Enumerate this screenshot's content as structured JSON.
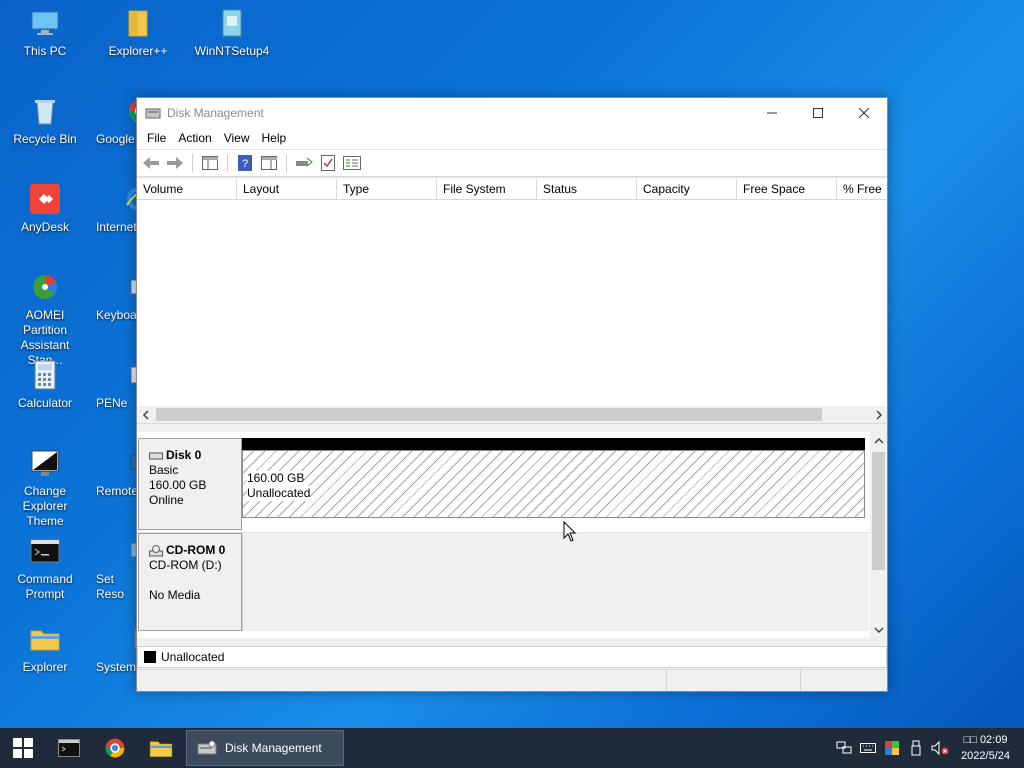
{
  "desktop": {
    "icons": [
      {
        "label": "This PC"
      },
      {
        "label": "Explorer++"
      },
      {
        "label": "WinNTSetup4"
      },
      {
        "label": "Recycle Bin"
      },
      {
        "label": "Google"
      },
      {
        "label": "AnyDesk"
      },
      {
        "label": "Internet"
      },
      {
        "label": "AOMEI Partition Assistant Stan..."
      },
      {
        "label": "Keyboa"
      },
      {
        "label": "Calculator"
      },
      {
        "label": "PENe"
      },
      {
        "label": "Change Explorer Theme"
      },
      {
        "label": "Remote"
      },
      {
        "label": "Command Prompt"
      },
      {
        "label": "Set Reso"
      },
      {
        "label": "Explorer"
      },
      {
        "label": "System"
      }
    ]
  },
  "window": {
    "title": "Disk Management",
    "menu": [
      "File",
      "Action",
      "View",
      "Help"
    ],
    "columns": [
      "Volume",
      "Layout",
      "Type",
      "File System",
      "Status",
      "Capacity",
      "Free Space",
      "% Free"
    ],
    "disks": [
      {
        "name": "Disk 0",
        "type": "Basic",
        "size": "160.00 GB",
        "status": "Online",
        "partition": {
          "size": "160.00 GB",
          "label": "Unallocated"
        }
      },
      {
        "name": "CD-ROM 0",
        "type": "CD-ROM (D:)",
        "status": "No Media"
      }
    ],
    "legend": "Unallocated"
  },
  "taskbar": {
    "active_app": "Disk Management",
    "clock_time": "□□ 02:09",
    "clock_date": "2022/5/24"
  },
  "colors": {
    "desktop_blue": "#0b74d8",
    "taskbar": "#1f2b3a",
    "unallocated": "#000000"
  }
}
